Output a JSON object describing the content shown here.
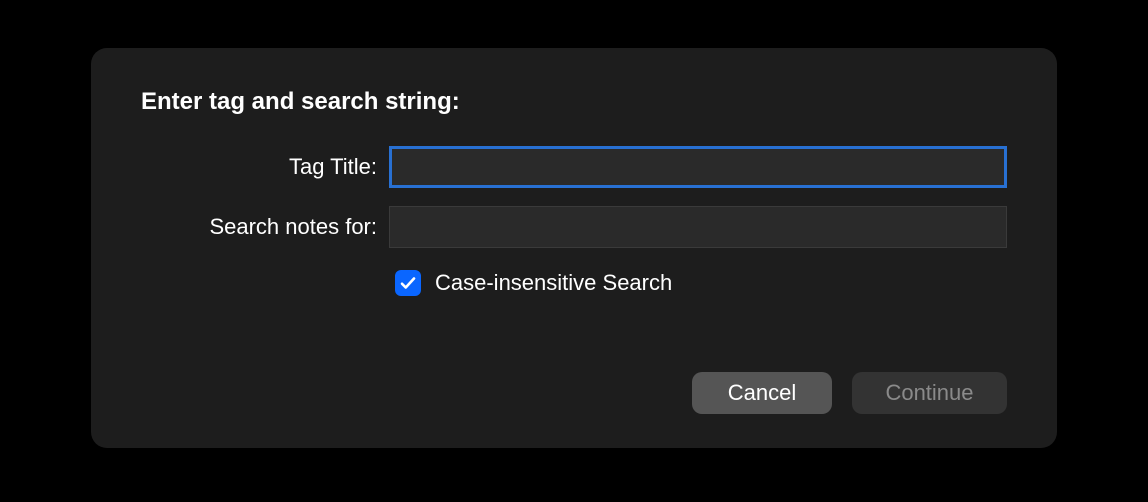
{
  "dialog": {
    "heading": "Enter tag and search string:"
  },
  "fields": {
    "tagTitle": {
      "label": "Tag Title:",
      "value": ""
    },
    "searchNotes": {
      "label": "Search notes for:",
      "value": ""
    }
  },
  "checkbox": {
    "caseInsensitive": {
      "label": "Case-insensitive Search",
      "checked": true
    }
  },
  "buttons": {
    "cancel": "Cancel",
    "continue": "Continue"
  }
}
